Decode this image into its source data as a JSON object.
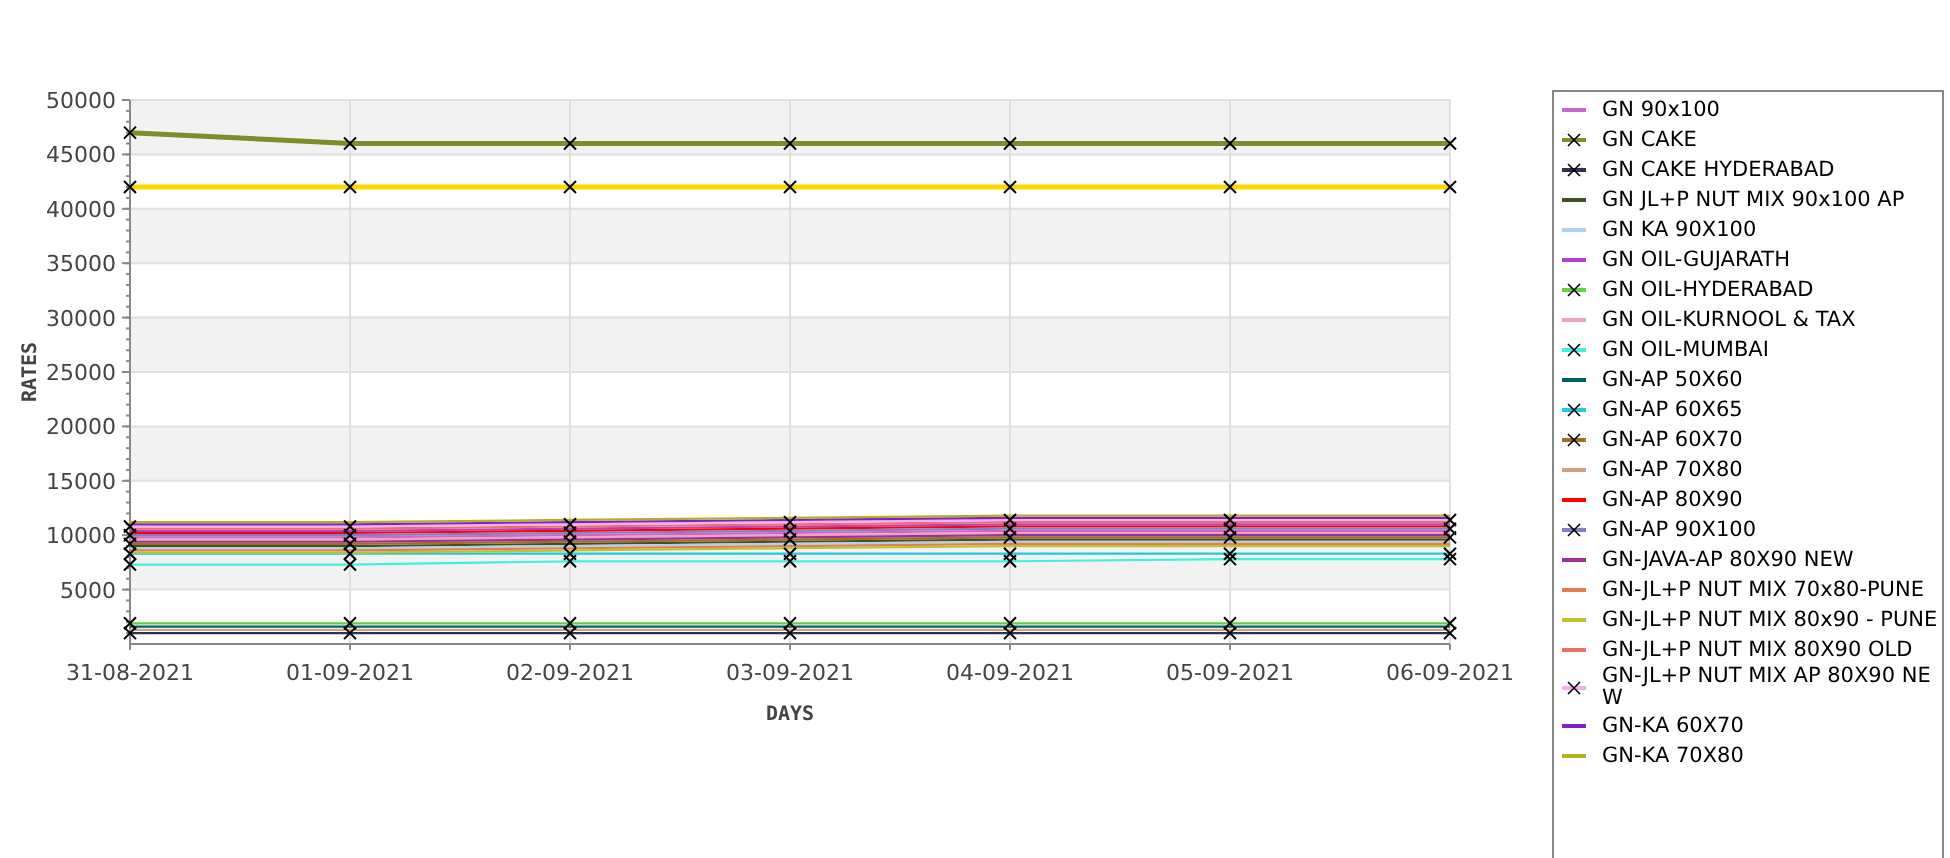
{
  "chart_data": {
    "type": "line",
    "xlabel": "DAYS",
    "ylabel": "RATES",
    "grid": true,
    "categories": [
      "31-08-2021",
      "01-09-2021",
      "02-09-2021",
      "03-09-2021",
      "04-09-2021",
      "05-09-2021",
      "06-09-2021"
    ],
    "ylim": [
      0,
      50000
    ],
    "yticks": [
      5000,
      10000,
      15000,
      20000,
      25000,
      30000,
      35000,
      40000,
      45000,
      50000
    ],
    "series": [
      {
        "name": "GN 90x100",
        "color": "#cc66cc",
        "values": [
          9800,
          9800,
          10000,
          10200,
          10400,
          10400,
          10400
        ]
      },
      {
        "name": "GN CAKE",
        "color": "#7f8c2a",
        "marker": "cross",
        "values": [
          47000,
          46000,
          46000,
          46000,
          46000,
          46000,
          46000
        ]
      },
      {
        "name": "GN CAKE HYDERABAD",
        "color": "#303050",
        "marker": "cross",
        "values": [
          1000,
          1000,
          1000,
          1000,
          1000,
          1000,
          1000
        ]
      },
      {
        "name": "GN JL+P NUT MIX 90x100 AP",
        "color": "#405020",
        "values": [
          9000,
          9000,
          9200,
          9400,
          9600,
          9600,
          9600
        ]
      },
      {
        "name": "GN KA 90X100",
        "color": "#b0d0f0",
        "values": [
          8800,
          8800,
          9000,
          9200,
          9400,
          9400,
          9400
        ]
      },
      {
        "name": "GN OIL-GUJARATH",
        "color": "#b040d0",
        "values": [
          10400,
          10400,
          10600,
          10800,
          11000,
          11000,
          11000
        ]
      },
      {
        "name": "GN OIL-HYDERABAD",
        "color": "#60d040",
        "marker": "cross",
        "values": [
          1900,
          1900,
          1900,
          1900,
          1900,
          1900,
          1900
        ]
      },
      {
        "name": "GN OIL-KURNOOL & TAX",
        "color": "#f0a0c0",
        "values": [
          9600,
          9600,
          9800,
          10000,
          10200,
          10200,
          10200
        ]
      },
      {
        "name": "GN OIL-MUMBAI",
        "color": "#40f0e0",
        "marker": "cross",
        "values": [
          7300,
          7300,
          7600,
          7600,
          7600,
          7800,
          7800
        ]
      },
      {
        "name": "GN-AP 50X60",
        "color": "#006060",
        "values": [
          1600,
          1600,
          1600,
          1600,
          1600,
          1600,
          1600
        ]
      },
      {
        "name": "GN-AP 60X65",
        "color": "#20c8e0",
        "marker": "cross",
        "values": [
          8300,
          8300,
          8300,
          8300,
          8300,
          8300,
          8300
        ]
      },
      {
        "name": "GN-AP 60X70",
        "color": "#a07020",
        "marker": "cross",
        "values": [
          9200,
          9200,
          9400,
          9600,
          9800,
          9800,
          9800
        ]
      },
      {
        "name": "GN-AP 70X80",
        "color": "#d0a080",
        "values": [
          1300,
          1300,
          1300,
          1300,
          1300,
          1300,
          1300
        ]
      },
      {
        "name": "GN-AP 80X90",
        "color": "#ff0000",
        "values": [
          10200,
          10200,
          10400,
          10600,
          10800,
          10800,
          10800
        ]
      },
      {
        "name": "GN-AP 90X100",
        "color": "#8080c0",
        "marker": "cross",
        "values": [
          10000,
          10000,
          10200,
          10400,
          10600,
          10600,
          10600
        ]
      },
      {
        "name": "GN-JAVA-AP 80X90 NEW",
        "color": "#a03090",
        "values": [
          9400,
          9400,
          9600,
          9800,
          10000,
          10000,
          10000
        ]
      },
      {
        "name": "GN-JL+P NUT MIX 70x80-PUNE",
        "color": "#e08050",
        "values": [
          8600,
          8600,
          8800,
          9000,
          9200,
          9200,
          9200
        ]
      },
      {
        "name": "GN-JL+P NUT MIX 80x90 - PUNE",
        "color": "#c0c030",
        "values": [
          8400,
          8400,
          8600,
          8800,
          9000,
          9000,
          9000
        ]
      },
      {
        "name": "GN-JL+P NUT MIX 80X90 OLD",
        "color": "#f07060",
        "values": [
          10600,
          10600,
          10800,
          11000,
          11200,
          11200,
          11200
        ]
      },
      {
        "name": "GN-JL+P NUT MIX AP 80X90 NEW",
        "color": "#f0b0f0",
        "marker": "cross",
        "values": [
          10800,
          10800,
          11000,
          11200,
          11400,
          11400,
          11400
        ]
      },
      {
        "name": "GN-KA 60X70",
        "color": "#8020d0",
        "values": [
          11000,
          11000,
          11200,
          11400,
          11600,
          11600,
          11600
        ]
      },
      {
        "name": "GN-KA 70X80",
        "color": "#b0b020",
        "values": [
          11200,
          11200,
          11400,
          11600,
          11800,
          11800,
          11800
        ]
      },
      {
        "color": "#ffd700",
        "marker": "cross",
        "values": [
          42000,
          42000,
          42000,
          42000,
          42000,
          42000,
          42000
        ]
      }
    ]
  }
}
